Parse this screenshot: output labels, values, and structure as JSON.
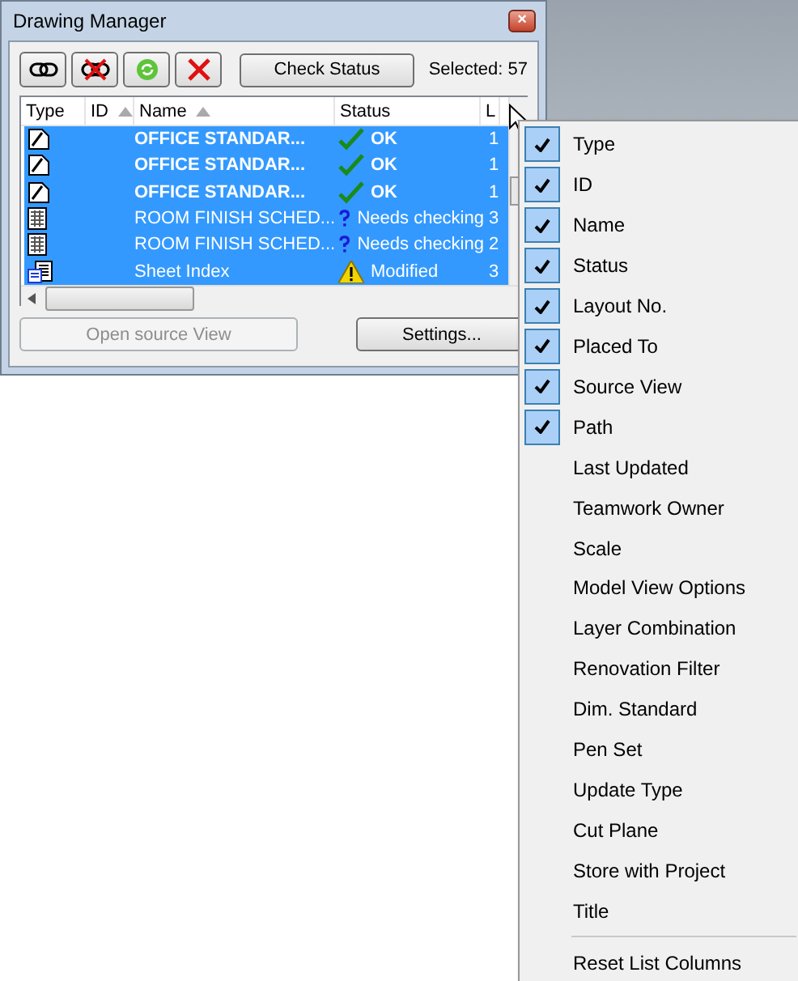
{
  "window": {
    "title": "Drawing Manager",
    "close": "×"
  },
  "toolbar": {
    "check_button": "Check Status",
    "selected": "Selected: 57"
  },
  "table": {
    "columns": [
      {
        "label": "Type",
        "sort": false
      },
      {
        "label": "ID",
        "sort": true
      },
      {
        "label": "Name",
        "sort": true
      },
      {
        "label": "Status",
        "sort": false
      },
      {
        "label": "L"
      }
    ],
    "rows": [
      {
        "kind": "drawing",
        "name": "OFFICE STANDAR...",
        "status": {
          "kind": "ok",
          "text": "OK"
        },
        "column_5": "1",
        "bold": true,
        "selected": true
      },
      {
        "kind": "drawing",
        "name": "OFFICE STANDAR...",
        "status": {
          "kind": "ok",
          "text": "OK"
        },
        "column_5": "1",
        "bold": true,
        "selected": true
      },
      {
        "kind": "drawing",
        "name": "OFFICE STANDAR...",
        "status": {
          "kind": "ok",
          "text": "OK"
        },
        "column_5": "1",
        "bold": true,
        "selected": true
      },
      {
        "kind": "schedule",
        "name": "ROOM FINISH SCHED...",
        "status": {
          "kind": "check",
          "text": "Needs checking"
        },
        "column_5": "3",
        "bold": false,
        "selected": true
      },
      {
        "kind": "schedule",
        "name": "ROOM FINISH SCHED...",
        "status": {
          "kind": "check",
          "text": "Needs checking"
        },
        "column_5": "2",
        "bold": false,
        "selected": true
      },
      {
        "kind": "index",
        "name": "Sheet Index",
        "status": {
          "kind": "modified",
          "text": "Modified"
        },
        "column_5": "3",
        "bold": false,
        "selected": true
      }
    ]
  },
  "buttons": [
    {
      "label": "Open source View",
      "disabled": true
    },
    {
      "label": "Settings...",
      "disabled": false
    }
  ],
  "menu": {
    "items": [
      {
        "label": "Type",
        "checked": true
      },
      {
        "label": "ID",
        "checked": true
      },
      {
        "label": "Name",
        "checked": true
      },
      {
        "label": "Status",
        "checked": true
      },
      {
        "label": "Layout No.",
        "checked": true
      },
      {
        "label": "Placed To",
        "checked": true
      },
      {
        "label": "Source View",
        "checked": true
      },
      {
        "label": "Path",
        "checked": true
      },
      {
        "label": "Last Updated",
        "checked": false
      },
      {
        "label": "Teamwork Owner",
        "checked": false
      },
      {
        "label": "Scale",
        "checked": false
      },
      {
        "label": "Model View Options",
        "checked": false
      },
      {
        "label": "Layer Combination",
        "checked": false
      },
      {
        "label": "Renovation Filter",
        "checked": false
      },
      {
        "label": "Dim. Standard",
        "checked": false
      },
      {
        "label": "Pen Set",
        "checked": false
      },
      {
        "label": "Update Type",
        "checked": false
      },
      {
        "label": "Cut Plane",
        "checked": false
      },
      {
        "label": "Store with Project",
        "checked": false
      },
      {
        "label": "Title",
        "checked": false
      }
    ],
    "footer": "Reset List Columns"
  }
}
